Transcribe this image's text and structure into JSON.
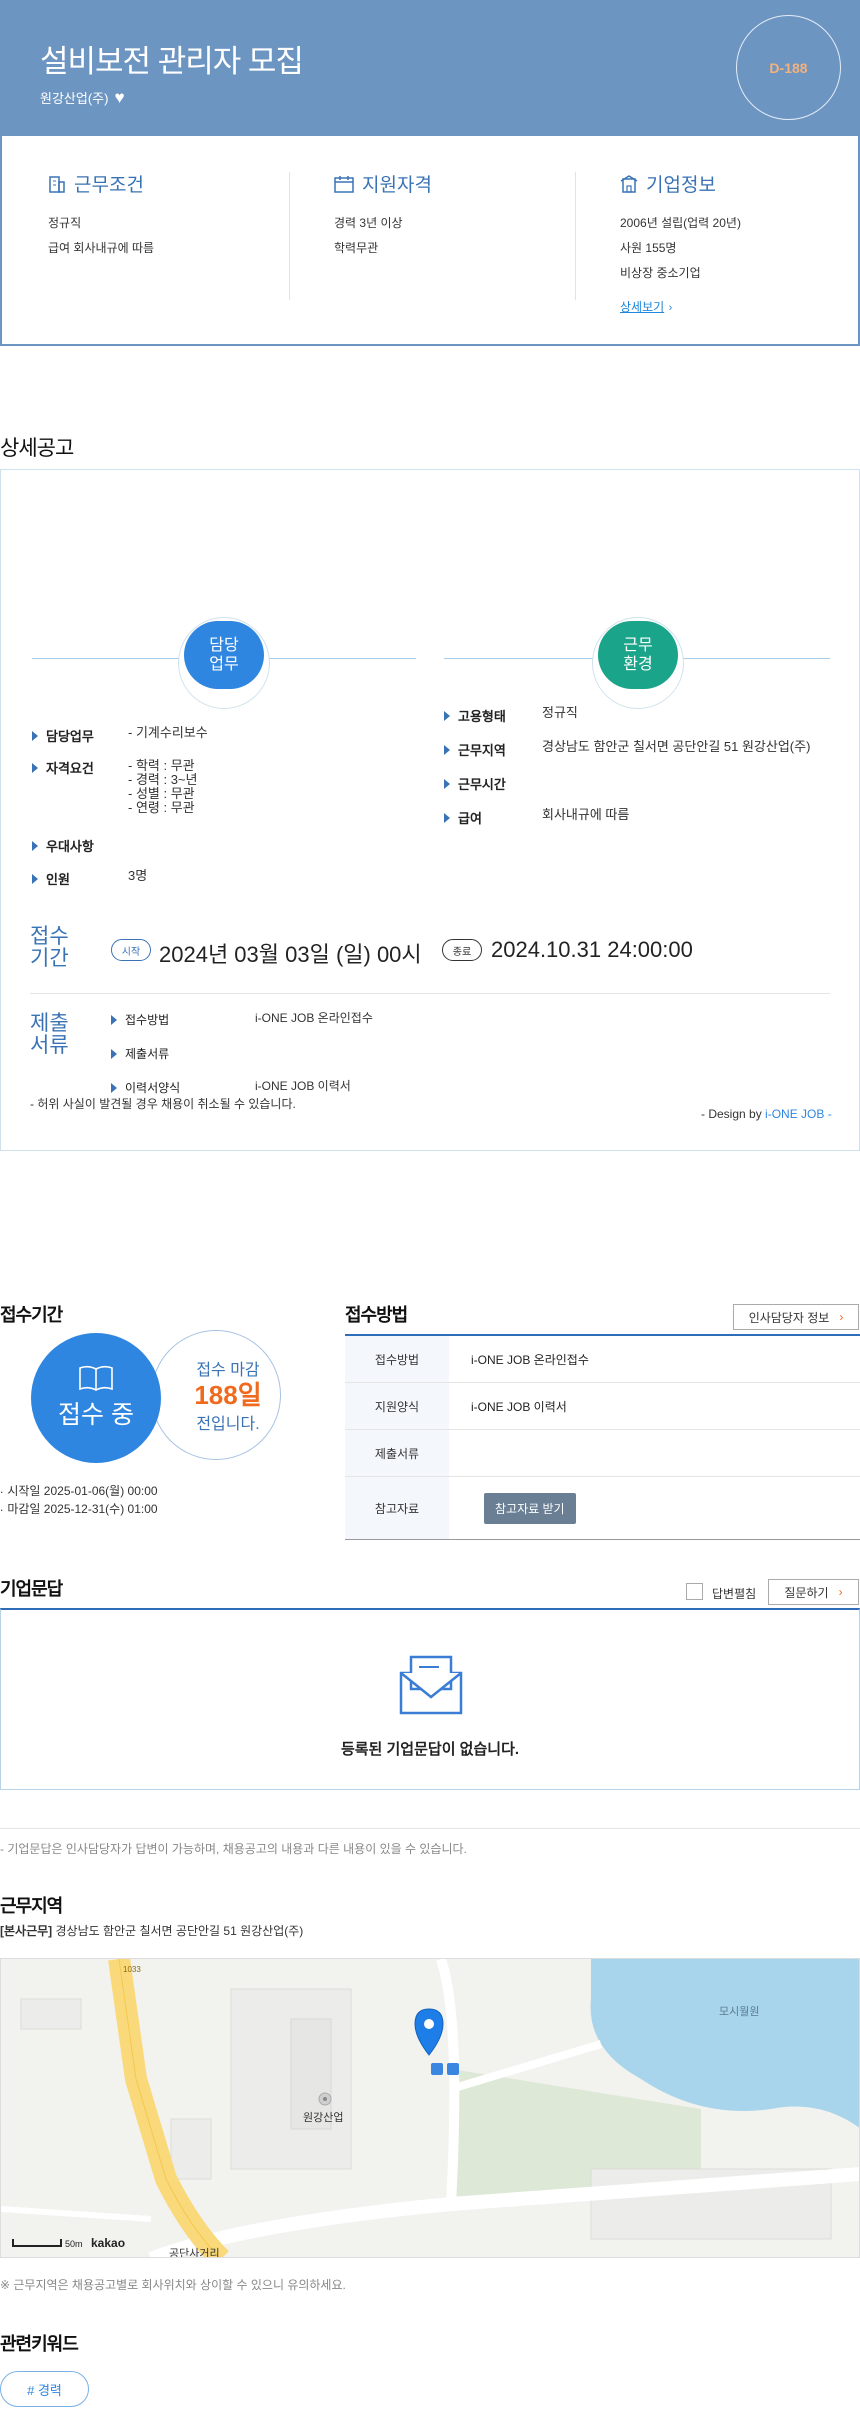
{
  "header": {
    "title": "설비보전 관리자 모집",
    "company": "원강산업(주)",
    "dday": "D-188"
  },
  "summary": {
    "work": {
      "title": "근무조건",
      "lines": [
        "정규직",
        "급여 회사내규에 따름"
      ]
    },
    "qual": {
      "title": "지원자격",
      "lines": [
        "경력 3년 이상",
        "학력무관"
      ]
    },
    "company": {
      "title": "기업정보",
      "lines": [
        "2006년 설립(업력 20년)",
        "사원 155명",
        "비상장 중소기업"
      ],
      "link": "상세보기"
    }
  },
  "detail": {
    "title": "상세공고",
    "left_circle": "담당\n업무",
    "right_circle": "근무\n환경",
    "left_rows": [
      {
        "label": "담당업무",
        "value": "- 기계수리보수"
      },
      {
        "label": "자격요건",
        "value": "- 학력 : 무관\n- 경력 : 3~년\n- 성별 : 무관\n- 연령 : 무관"
      },
      {
        "label": "우대사항",
        "value": ""
      },
      {
        "label": "인원",
        "value": "3명"
      }
    ],
    "right_rows": [
      {
        "label": "고용형태",
        "value": "정규직"
      },
      {
        "label": "근무지역",
        "value": "경상남도 함안군 칠서면 공단안길 51 원강산업(주)"
      },
      {
        "label": "근무시간",
        "value": ""
      },
      {
        "label": "급여",
        "value": "회사내규에 따름"
      }
    ],
    "period_label": "접수\n기간",
    "start_pill": "시작",
    "start_text": "2024년 03월 03일 (일) 00시",
    "end_pill": "종료",
    "end_text": "2024.10.31 24:00:00",
    "docs_label": "제출\n서류",
    "docs_rows": [
      {
        "label": "접수방법",
        "value": "i-ONE JOB 온라인접수"
      },
      {
        "label": "제출서류",
        "value": ""
      },
      {
        "label": "이력서양식",
        "value": "i-ONE JOB 이력서"
      }
    ],
    "warning": "- 허위 사실이 발견될 경우 채용이 취소될 수 있습니다.",
    "design_prefix": "- Design by ",
    "design_brand": "i-ONE JOB -"
  },
  "apply": {
    "period_title": "접수기간",
    "status": "접수 중",
    "deadline_label": "접수 마감",
    "days_left": "188일",
    "days_suffix": "전입니다.",
    "start_date": "시작일 2025-01-06(월) 00:00",
    "end_date": "마감일 2025-12-31(수) 01:00",
    "method_title": "접수방법",
    "hr_button": "인사담당자 정보",
    "table": [
      {
        "key": "접수방법",
        "value": "i-ONE JOB 온라인접수"
      },
      {
        "key": "지원양식",
        "value": "i-ONE JOB 이력서"
      },
      {
        "key": "제출서류",
        "value": ""
      },
      {
        "key": "참고자료",
        "button": "참고자료 받기"
      }
    ]
  },
  "qna": {
    "title": "기업문답",
    "checkbox_label": "답변펼침",
    "ask_button": "질문하기",
    "empty_text": "등록된 기업문답이 없습니다.",
    "note": "- 기업문답은 인사담당자가 답변이 가능하며, 채용공고의 내용과 다른 내용이 있을 수 있습니다."
  },
  "location": {
    "title": "근무지역",
    "tag": "[본사근무]",
    "address": "경상남도 함안군 칠서면 공단안길 51 원강산업(주)",
    "map_labels": {
      "company": "원강산업",
      "lake": "모시월원",
      "crossroad": "공단사거리",
      "road": "1033",
      "scale": "50m",
      "brand": "kakao"
    },
    "note": "※ 근무지역은 채용공고별로 회사위치와 상이할 수 있으니 유의하세요."
  },
  "keywords": {
    "title": "관련키워드",
    "items": [
      "# 경력"
    ]
  },
  "colors": {
    "header_bg": "#6d95c2",
    "accent_blue": "#2f86e0",
    "accent_green": "#1aa58a",
    "deadline_orange": "#f06a1d"
  }
}
